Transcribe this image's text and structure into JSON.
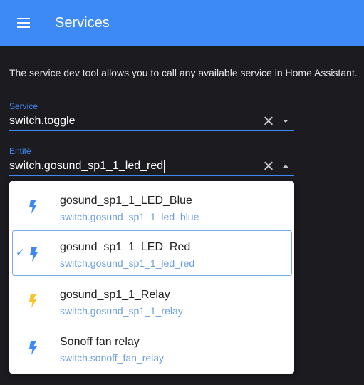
{
  "appbar": {
    "title": "Services",
    "menu_icon": "menu-icon",
    "color": "#3d8af7"
  },
  "description": "The service dev tool allows you to call any available service in Home Assistant.",
  "service_field": {
    "label": "Service",
    "value": "switch.toggle"
  },
  "entity_field": {
    "label": "Entité",
    "value": "switch.gosund_sp1_1_led_red"
  },
  "dropdown": {
    "items": [
      {
        "name": "gosund_sp1_1_LED_Blue",
        "entity_id": "switch.gosund_sp1_1_led_blue",
        "icon": "flash-icon",
        "icon_color": "#3d8af7",
        "selected": false
      },
      {
        "name": "gosund_sp1_1_LED_Red",
        "entity_id": "switch.gosund_sp1_1_led_red",
        "icon": "flash-icon",
        "icon_color": "#3d8af7",
        "selected": true
      },
      {
        "name": "gosund_sp1_1_Relay",
        "entity_id": "switch.gosund_sp1_1_relay",
        "icon": "flash-icon",
        "icon_color": "#f5c42f",
        "selected": false
      },
      {
        "name": "Sonoff fan relay",
        "entity_id": "switch.sonoff_fan_relay",
        "icon": "flash-icon",
        "icon_color": "#3d8af7",
        "selected": false
      }
    ]
  }
}
